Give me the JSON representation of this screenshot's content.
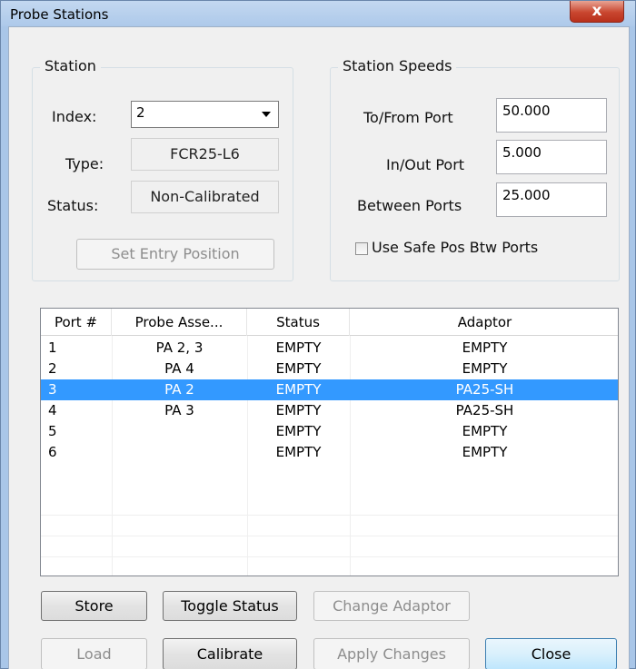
{
  "window": {
    "title": "Probe Stations",
    "close_glyph": "x"
  },
  "station": {
    "group_title": "Station",
    "index_label": "Index:",
    "index_value": "2",
    "type_label": "Type:",
    "type_value": "FCR25-L6",
    "status_label": "Status:",
    "status_value": "Non-Calibrated",
    "set_entry_button": "Set Entry Position"
  },
  "speeds": {
    "group_title": "Station Speeds",
    "to_from_label": "To/From Port",
    "to_from_value": "50.000",
    "in_out_label": "In/Out Port",
    "in_out_value": "5.000",
    "between_label": "Between Ports",
    "between_value": "25.000",
    "safe_pos_label": "Use Safe Pos Btw Ports",
    "safe_pos_checked": false
  },
  "table": {
    "columns": [
      "Port #",
      "Probe Asse...",
      "Status",
      "Adaptor"
    ],
    "rows": [
      {
        "port": "1",
        "probe": "PA 2, 3",
        "status": "EMPTY",
        "adaptor": "EMPTY",
        "selected": false
      },
      {
        "port": "2",
        "probe": "PA 4",
        "status": "EMPTY",
        "adaptor": "EMPTY",
        "selected": false
      },
      {
        "port": "3",
        "probe": "PA 2",
        "status": "EMPTY",
        "adaptor": "PA25-SH",
        "selected": true
      },
      {
        "port": "4",
        "probe": "PA 3",
        "status": "EMPTY",
        "adaptor": "PA25-SH",
        "selected": false
      },
      {
        "port": "5",
        "probe": "",
        "status": "EMPTY",
        "adaptor": "EMPTY",
        "selected": false
      },
      {
        "port": "6",
        "probe": "",
        "status": "EMPTY",
        "adaptor": "EMPTY",
        "selected": false
      }
    ]
  },
  "buttons": {
    "store": "Store",
    "toggle_status": "Toggle Status",
    "change_adaptor": "Change Adaptor",
    "load": "Load",
    "calibrate": "Calibrate",
    "apply_changes": "Apply Changes",
    "close": "Close"
  },
  "colors": {
    "selection": "#3399ff",
    "title_bar": "#adc9ea",
    "close_button": "#c9462f"
  }
}
